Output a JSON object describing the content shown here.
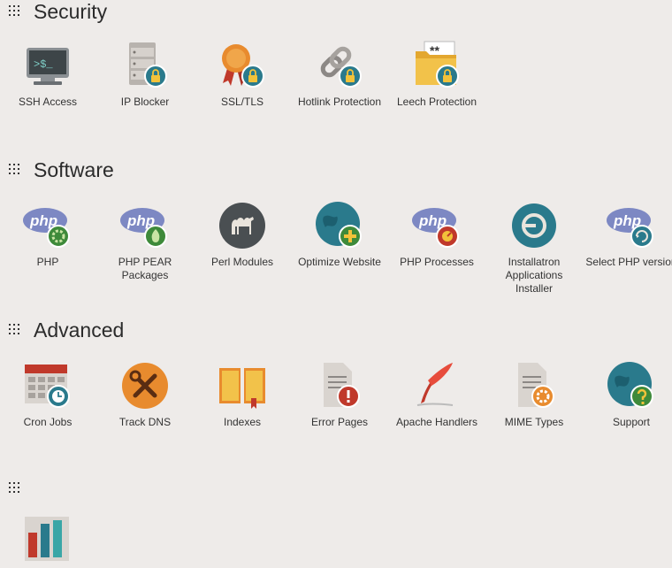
{
  "sections": {
    "security": {
      "title": "Security",
      "items": [
        "SSH Access",
        "IP Blocker",
        "SSL/TLS",
        "Hotlink Protection",
        "Leech Protection"
      ]
    },
    "software": {
      "title": "Software",
      "items": [
        "PHP",
        "PHP PEAR Packages",
        "Perl Modules",
        "Optimize Website",
        "PHP Processes",
        "Installatron Applications Installer",
        "Select PHP version"
      ]
    },
    "advanced": {
      "title": "Advanced",
      "items": [
        "Cron Jobs",
        "Track DNS",
        "Indexes",
        "Error Pages",
        "Apache Handlers",
        "MIME Types",
        "Support"
      ]
    },
    "stats": {
      "title": ""
    }
  },
  "icon_texts": {
    "terminal": ">$_",
    "php": "php",
    "password": "**"
  },
  "colors": {
    "background": "#eeebe9",
    "teal": "#2a7a8c",
    "green": "#3e8a3a",
    "orange": "#e88b2e",
    "php_blue": "#7d88c3"
  }
}
